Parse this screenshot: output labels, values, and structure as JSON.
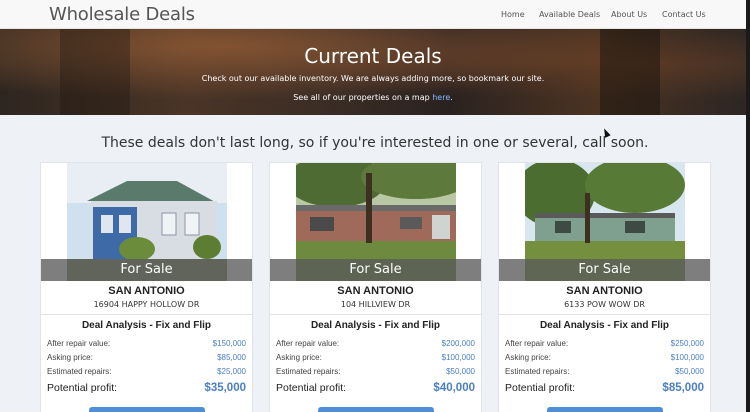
{
  "navbar": {
    "brand": "Wholesale Deals",
    "links": [
      "Home",
      "Available Deals",
      "About Us",
      "Contact Us"
    ]
  },
  "hero": {
    "title": "Current Deals",
    "subtitle": "Check out our available inventory. We are always adding more, so bookmark our site.",
    "map_prefix": "See all of our properties on a map ",
    "map_link": "here",
    "map_suffix": "."
  },
  "tagline": "These deals don't last long, so if you're interested in one or several, call soon.",
  "labels": {
    "for_sale": "For Sale",
    "analysis_title": "Deal Analysis - Fix and Flip",
    "arv": "After repair value:",
    "asking": "Asking price:",
    "repairs": "Estimated repairs:",
    "profit": "Potential profit:"
  },
  "deals": [
    {
      "city": "SAN ANTONIO",
      "address": "16904 HAPPY HOLLOW DR",
      "arv": "$150,000",
      "asking": "$85,000",
      "repairs": "$25,000",
      "profit": "$35,000"
    },
    {
      "city": "SAN ANTONIO",
      "address": "104 HILLVIEW DR",
      "arv": "$200,000",
      "asking": "$100,000",
      "repairs": "$50,000",
      "profit": "$40,000"
    },
    {
      "city": "SAN ANTONIO",
      "address": "6133 POW WOW DR",
      "arv": "$250,000",
      "asking": "$100,000",
      "repairs": "$50,000",
      "profit": "$85,000"
    }
  ],
  "colors": {
    "accent": "#4a7fc1",
    "button": "#4f8fd8"
  },
  "icons": [
    "cursor-icon"
  ]
}
